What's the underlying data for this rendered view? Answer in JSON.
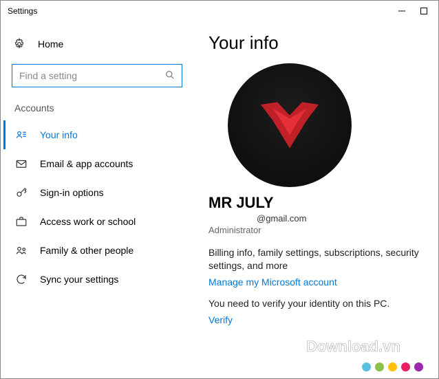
{
  "window": {
    "title": "Settings"
  },
  "sidebar": {
    "home": "Home",
    "search_placeholder": "Find a setting",
    "section": "Accounts",
    "items": [
      {
        "label": "Your info"
      },
      {
        "label": "Email & app accounts"
      },
      {
        "label": "Sign-in options"
      },
      {
        "label": "Access work or school"
      },
      {
        "label": "Family & other people"
      },
      {
        "label": "Sync your settings"
      }
    ]
  },
  "main": {
    "title": "Your info",
    "user_name": "MR JULY",
    "user_email": "@gmail.com",
    "user_role": "Administrator",
    "description": "Billing info, family settings, subscriptions, security settings, and more",
    "manage_link": "Manage my Microsoft account",
    "verify_prompt": "You need to verify your identity on this PC.",
    "verify_link": "Verify"
  },
  "watermark": {
    "text": "Download.vn"
  },
  "colors": {
    "accent": "#0078d7",
    "dots": [
      "#5bc0de",
      "#8bc34a",
      "#ffc107",
      "#e91e63",
      "#9c27b0"
    ]
  }
}
